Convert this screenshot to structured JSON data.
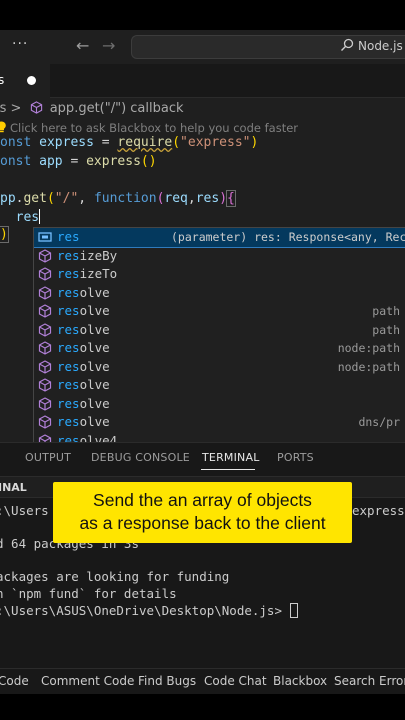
{
  "titlebar": {
    "menu_glyph": "···",
    "back_glyph": "←",
    "forward_glyph": "→",
    "command_center_label": "Node.js"
  },
  "tabs": {
    "active_name": "s"
  },
  "breadcrumb": {
    "file": "js",
    "separator": ">",
    "symbol": "app.get(\"/\") callback"
  },
  "hint": "Click here to ask Blackbox to help you code faster",
  "code": {
    "line1": {
      "kw": "onst",
      "var": "express",
      "op": " = ",
      "fn": "require",
      "open": "(",
      "str": "\"express\"",
      "close": ")"
    },
    "line2": {
      "kw": "onst",
      "var": "app",
      "op": " = ",
      "fn": "express",
      "parens": "()"
    },
    "line4": {
      "var": "pp",
      "dot": ".",
      "fn": "get",
      "open": "(",
      "str": "\"/\"",
      "comma": ", ",
      "kw": "function",
      "popen": "(",
      "p1": "req",
      "pcomma": ",",
      "p2": "res",
      "pclose": ")",
      "brace": "{"
    },
    "line5": {
      "indent": "  ",
      "var": "res"
    },
    "line6": {
      "close": ")"
    }
  },
  "suggest": {
    "items": [
      {
        "match": "res",
        "rest": "",
        "detail": "(parameter) res: Response<any, Recor",
        "selected": true
      },
      {
        "match": "res",
        "rest": "izeBy",
        "detail": ""
      },
      {
        "match": "res",
        "rest": "izeTo",
        "detail": ""
      },
      {
        "match": "res",
        "rest": "olve",
        "detail": ""
      },
      {
        "match": "res",
        "rest": "olve",
        "detail": "path"
      },
      {
        "match": "res",
        "rest": "olve",
        "detail": "path"
      },
      {
        "match": "res",
        "rest": "olve",
        "detail": "node:path"
      },
      {
        "match": "res",
        "rest": "olve",
        "detail": "node:path"
      },
      {
        "match": "res",
        "rest": "olve",
        "detail": ""
      },
      {
        "match": "res",
        "rest": "olve",
        "detail": ""
      },
      {
        "match": "res",
        "rest": "olve",
        "detail": "dns/pr"
      },
      {
        "match": "res",
        "rest": "olve4",
        "detail": ""
      }
    ]
  },
  "panel": {
    "tabs": [
      "OUTPUT",
      "DEBUG CONSOLE",
      "TERMINAL",
      "PORTS"
    ],
    "active_tab": "TERMINAL",
    "header": "INAL",
    "terminal_lines": [
      ":\\Users",
      "express",
      "d 64 packages in 3s",
      "ackages are looking for funding",
      "n `npm fund` for details",
      ":\\Users\\ASUS\\OneDrive\\Desktop\\Node.js> "
    ]
  },
  "caption": {
    "line1": "Send the an array of objects",
    "line2": "as a response back to the client"
  },
  "statusbar": {
    "items": [
      "Code",
      "Comment Code",
      "Find Bugs",
      "Code Chat",
      "Blackbox",
      "Search Error"
    ]
  },
  "colors": {
    "editor_bg": "#1f1f1f",
    "panel_bg": "#181818",
    "selection": "#04395e",
    "match_highlight": "#2aaaff",
    "caption_bg": "#ffe500",
    "cube_icon": "#b180d7",
    "hint_bulb": "#ffcc00"
  },
  "icons": {
    "search": "search-icon",
    "symbol": "cube-icon",
    "parameter": "variable-icon",
    "method": "method-cube-icon",
    "hint": "lightbulb-icon"
  }
}
